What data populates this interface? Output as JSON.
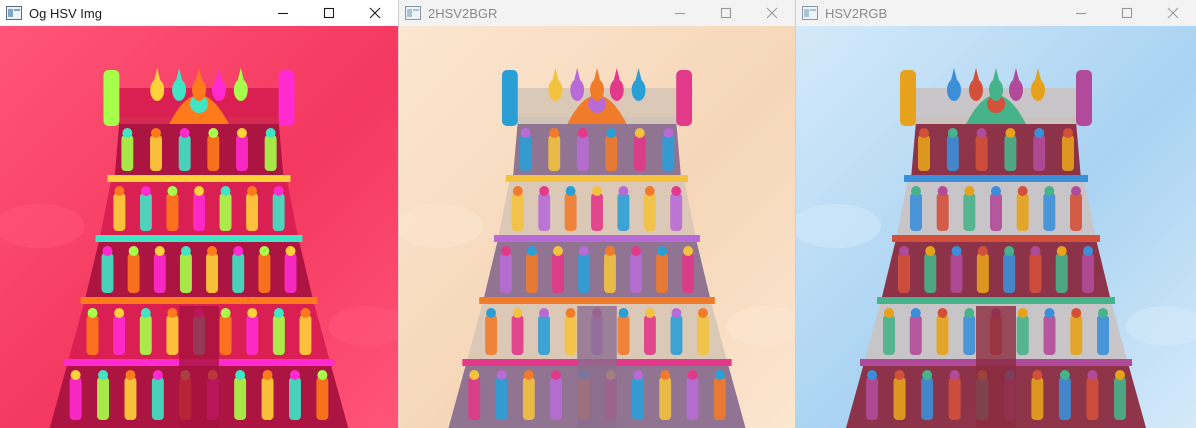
{
  "windows": [
    {
      "title": "Og HSV Img",
      "state": "active",
      "image_label": "temple gopuram rendered in HSV channel colors",
      "palette": {
        "sky": "#f4385f",
        "sky2": "#ff5578",
        "tower": "#d81d52",
        "tower_dark": "#a8123f",
        "accent1": "#a6ff4a",
        "accent2": "#ffd23a",
        "accent3": "#3fe6c6",
        "accent4": "#ff7a1a",
        "accent5": "#ff2ad0"
      }
    },
    {
      "title": "2HSV2BGR",
      "state": "inactive",
      "image_label": "temple gopuram with warm peach sky",
      "palette": {
        "sky": "#f6d6b8",
        "sky2": "#fbe6d0",
        "tower": "#d9c7b6",
        "tower_dark": "#8b6e8f",
        "accent1": "#2a9fd6",
        "accent2": "#f3c23e",
        "accent3": "#b86bd6",
        "accent4": "#f07b2b",
        "accent5": "#e2398a"
      }
    },
    {
      "title": "HSV2RGB",
      "state": "inactive",
      "image_label": "temple gopuram with blue sky",
      "palette": {
        "sky": "#a9d3f2",
        "sky2": "#d4e9f9",
        "tower": "#c9c4c6",
        "tower_dark": "#8b2a3f",
        "accent1": "#e6a21c",
        "accent2": "#3b8fd8",
        "accent3": "#d3503a",
        "accent4": "#47b38a",
        "accent5": "#b14a9a"
      }
    }
  ],
  "controls": {
    "minimize_icon": "minimize-icon",
    "maximize_icon": "maximize-icon",
    "close_icon": "close-icon"
  }
}
